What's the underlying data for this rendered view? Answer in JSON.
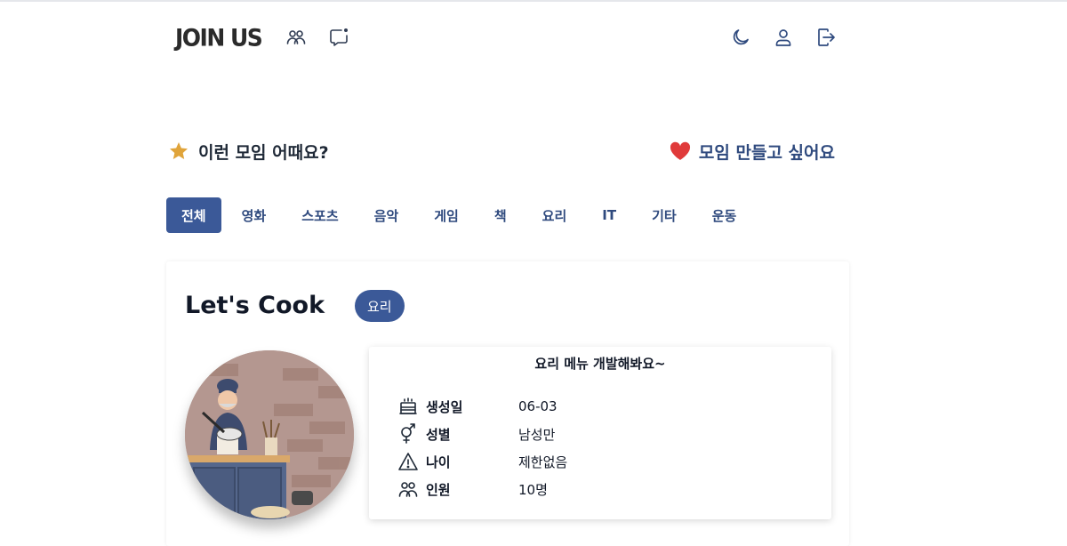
{
  "header": {
    "logo": "JOIN US",
    "nav_icons": [
      "group-icon",
      "chat-notification-icon"
    ],
    "right_icons": [
      "moon-icon",
      "user-icon",
      "logout-icon"
    ]
  },
  "section": {
    "title": "이런 모임 어때요?",
    "make_label": "모임 만들고 싶어요",
    "colors": {
      "star": "#e0a43a",
      "heart": "#e03a3a",
      "accent": "#3b5998",
      "link": "#2f4a7e"
    }
  },
  "tabs": [
    {
      "label": "전체",
      "active": true
    },
    {
      "label": "영화"
    },
    {
      "label": "스포츠"
    },
    {
      "label": "음악"
    },
    {
      "label": "게임"
    },
    {
      "label": "책"
    },
    {
      "label": "요리"
    },
    {
      "label": "IT"
    },
    {
      "label": "기타"
    },
    {
      "label": "운동"
    }
  ],
  "card": {
    "title": "Let's Cook",
    "category": "요리",
    "description": "요리 메뉴 개발해봐요~",
    "rows": [
      {
        "icon": "cake-icon",
        "label": "생성일",
        "value": "06-03"
      },
      {
        "icon": "gender-icon",
        "label": "성별",
        "value": "남성만"
      },
      {
        "icon": "warning-icon",
        "label": "나이",
        "value": "제한없음"
      },
      {
        "icon": "people-icon",
        "label": "인원",
        "value": "10명"
      }
    ]
  }
}
